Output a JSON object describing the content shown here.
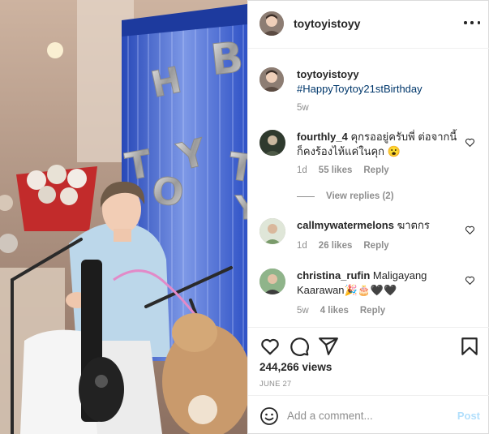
{
  "post": {
    "author": "toytoyistoyy",
    "caption_hashtag": "#HappyToytoy21stBirthday",
    "caption_age": "5w",
    "views": "244,266 views",
    "date": "JUNE 27"
  },
  "media": {
    "balloon_letters": [
      "H",
      "B",
      "T",
      "O",
      "Y",
      "T",
      "Y"
    ]
  },
  "comments": [
    {
      "username": "fourthly_4",
      "text": "คุกรออยู่ครับพี่ ต่อจากนี้ก็คงร้องไห้แค่ในคุก 😮",
      "age": "1d",
      "likes": "55 likes",
      "reply": "Reply",
      "view_replies": "View replies (2)"
    },
    {
      "username": "callmywatermelons",
      "text": "ฆาตกร",
      "age": "1d",
      "likes": "26 likes",
      "reply": "Reply"
    },
    {
      "username": "christina_rufin",
      "text": "Maligayang Kaarawan🎉🎂🖤🖤",
      "age": "5w",
      "likes": "4 likes",
      "reply": "Reply"
    }
  ],
  "add_comment": {
    "placeholder": "Add a comment...",
    "post_label": "Post"
  },
  "icons": {
    "more": "more-options-icon",
    "like": "heart-icon",
    "comment": "comment-icon",
    "share": "share-icon",
    "save": "bookmark-icon",
    "emoji": "emoji-icon"
  },
  "colors": {
    "text": "#262626",
    "muted": "#8e8e8e",
    "hashtag": "#00376b",
    "post_disabled": "#b2dffc",
    "border": "#dbdbdb",
    "curtain": "#2a4fc4"
  }
}
